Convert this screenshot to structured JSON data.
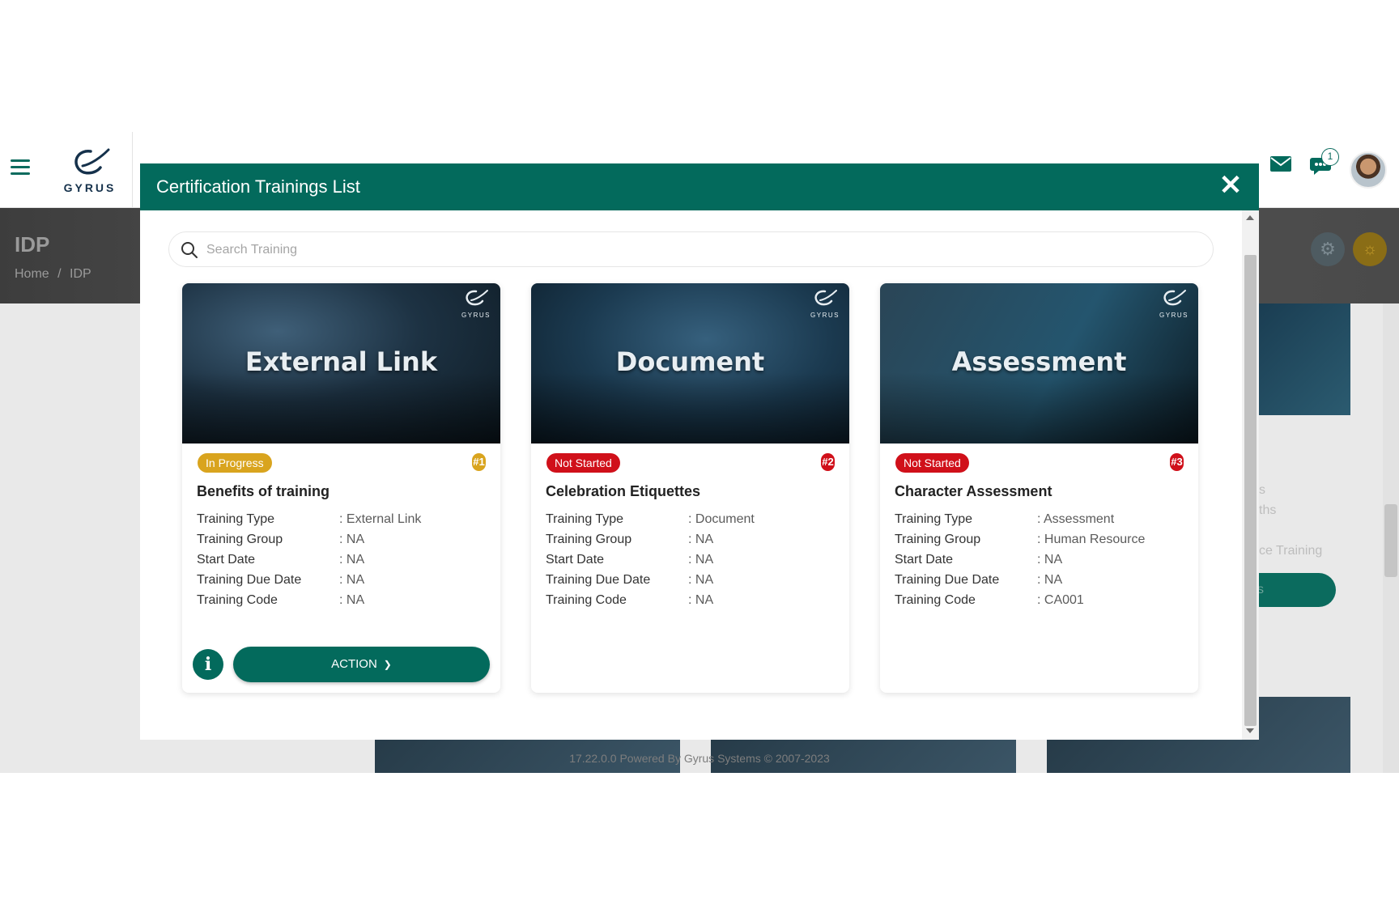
{
  "app": {
    "logo_text": "GYRUS",
    "notification_count": "1",
    "page_title": "IDP",
    "breadcrumb": {
      "home": "Home",
      "separator": "/",
      "current": "IDP"
    },
    "bg_side_texts": [
      "s",
      "ths",
      "ce Training"
    ],
    "bg_side_button": "s",
    "footer": "17.22.0.0 Powered By Gyrus Systems © 2007-2023"
  },
  "modal": {
    "title": "Certification Trainings List",
    "close_label": "✕",
    "search": {
      "placeholder": "Search Training",
      "value": ""
    },
    "cards": [
      {
        "image_label": "External Link",
        "status": "In Progress",
        "rank": "#1",
        "title": "Benefits of training",
        "fields": [
          {
            "label": "Training Type",
            "value": ": External Link"
          },
          {
            "label": "Training Group",
            "value": ": NA"
          },
          {
            "label": "Start Date",
            "value": ": NA"
          },
          {
            "label": "Training Due Date",
            "value": ": NA"
          },
          {
            "label": "Training Code",
            "value": ":  NA"
          }
        ],
        "info_label": "i",
        "action_label": "ACTION"
      },
      {
        "image_label": "Document",
        "status": "Not Started",
        "rank": "#2",
        "title": "Celebration Etiquettes",
        "fields": [
          {
            "label": "Training Type",
            "value": ": Document"
          },
          {
            "label": "Training Group",
            "value": ": NA"
          },
          {
            "label": "Start Date",
            "value": ": NA"
          },
          {
            "label": "Training Due Date",
            "value": ": NA"
          },
          {
            "label": "Training Code",
            "value": ":  NA"
          }
        ]
      },
      {
        "image_label": "Assessment",
        "status": "Not Started",
        "rank": "#3",
        "title": "Character Assessment",
        "fields": [
          {
            "label": "Training Type",
            "value": ": Assessment"
          },
          {
            "label": "Training Group",
            "value": ": Human Resource"
          },
          {
            "label": "Start Date",
            "value": ": NA"
          },
          {
            "label": "Training Due Date",
            "value": ": NA"
          },
          {
            "label": "Training Code",
            "value": ":  CA001"
          }
        ]
      }
    ]
  },
  "icons": {
    "menu": "hamburger-icon",
    "search": "search-icon",
    "mail": "mail-icon",
    "chat": "chat-icon",
    "settings": "gear-icon",
    "idea": "lightbulb-icon",
    "close": "close-icon",
    "info": "info-icon",
    "dropdown": "chevron-down-icon"
  },
  "colors": {
    "primary": "#036a5c",
    "in_progress": "#d9a41e",
    "not_started": "#d0101a"
  }
}
